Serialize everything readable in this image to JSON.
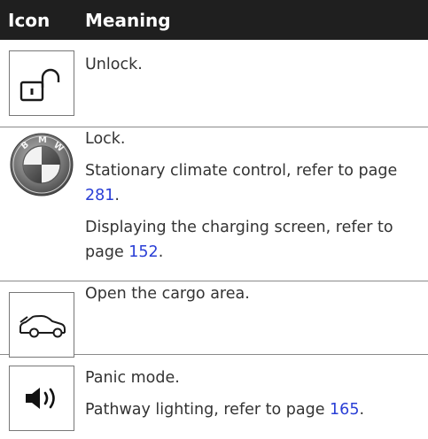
{
  "header": {
    "icon_label": "Icon",
    "meaning_label": "Meaning"
  },
  "rows": [
    {
      "icon": "unlock-padlock-icon",
      "meaning": [
        {
          "text": "Unlock."
        }
      ]
    },
    {
      "icon": "bmw-logo-icon",
      "meaning": [
        {
          "text": "Lock."
        },
        {
          "text": "Stationary climate control, refer to page ",
          "page": "281",
          "suffix": "."
        },
        {
          "text": "Displaying the charging screen, refer to page ",
          "page": "152",
          "suffix": "."
        }
      ]
    },
    {
      "icon": "car-trunk-icon",
      "meaning": [
        {
          "text": "Open the cargo area."
        }
      ]
    },
    {
      "icon": "horn-speaker-icon",
      "meaning": [
        {
          "text": "Panic mode."
        },
        {
          "text": "Pathway lighting, refer to page ",
          "page": "165",
          "suffix": "."
        }
      ]
    }
  ],
  "logo_text": [
    "B",
    "M",
    "W"
  ],
  "colors": {
    "header_bg": "#1f1f1f",
    "link": "#2a3fd6",
    "divider": "#8a8a8a"
  }
}
